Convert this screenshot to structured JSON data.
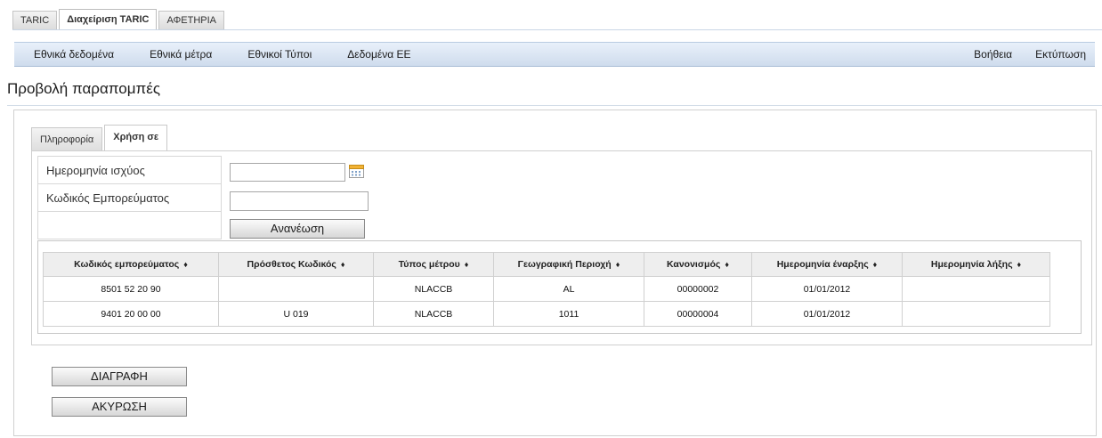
{
  "top_tabs": [
    {
      "label": "TARIC",
      "active": false
    },
    {
      "label": "Διαχείριση TARIC",
      "active": true
    },
    {
      "label": "ΑΦΕΤΗΡΙΑ",
      "active": false
    }
  ],
  "menu": {
    "left": [
      "Εθνικά δεδομένα",
      "Εθνικά μέτρα",
      "Εθνικοί Τύποι",
      "Δεδομένα ΕΕ"
    ],
    "right": [
      "Βοήθεια",
      "Εκτύπωση"
    ]
  },
  "page_title": "Προβολή παραπομπές",
  "inner_tabs": [
    {
      "label": "Πληροφορία",
      "active": false
    },
    {
      "label": "Χρήση σε",
      "active": true
    }
  ],
  "form": {
    "date_label": "Ημερομηνία ισχύος",
    "date_value": "",
    "code_label": "Κωδικός Εμπορεύματος",
    "code_value": "",
    "refresh_label": "Ανανέωση"
  },
  "table": {
    "columns": [
      "Κωδικός εμπορεύματος",
      "Πρόσθετος Κωδικός",
      "Τύπος μέτρου",
      "Γεωγραφική Περιοχή",
      "Κανονισμός",
      "Ημερομηνία έναρξης",
      "Ημερομηνία λήξης"
    ],
    "rows": [
      [
        "8501 52 20 90",
        "",
        "NLACCB",
        "AL",
        "00000002",
        "01/01/2012",
        ""
      ],
      [
        "9401 20 00 00",
        "U 019",
        "NLACCB",
        "1011",
        "00000004",
        "01/01/2012",
        ""
      ]
    ]
  },
  "buttons": {
    "delete": "ΔΙΑΓΡΑΦΗ",
    "cancel": "ΑΚΥΡΩΣΗ"
  },
  "icons": {
    "calendar": "calendar-icon",
    "sort": "sort-icon"
  },
  "colors": {
    "menu_bg": "#d9e4f2",
    "header_bg": "#eeeeee",
    "calendar_accent": "#f2b233"
  }
}
